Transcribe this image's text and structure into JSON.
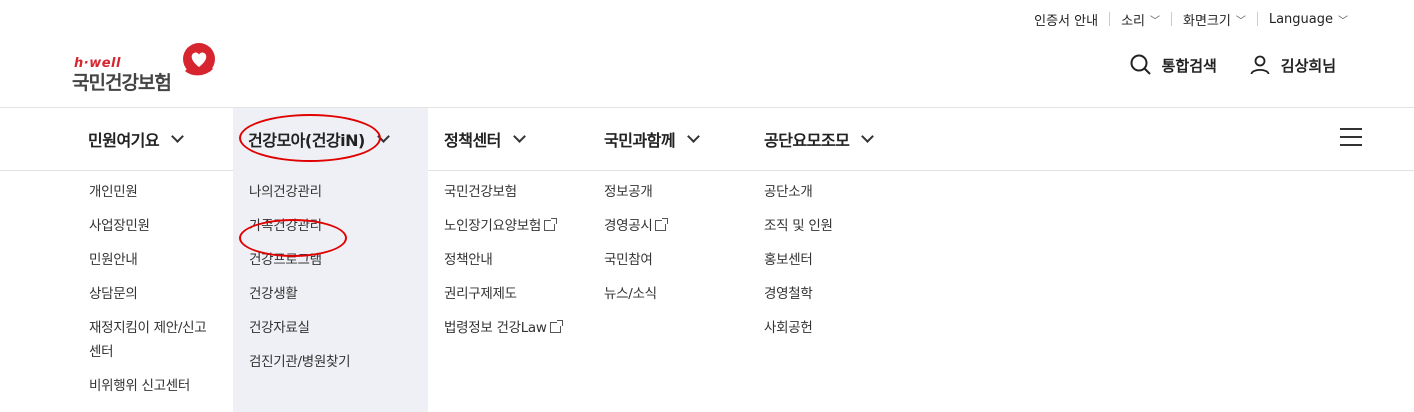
{
  "utility": {
    "cert": "인증서 안내",
    "sound": "소리",
    "screen_size": "화면크기",
    "language": "Language"
  },
  "logo": {
    "hwell": "h·well",
    "name": "국민건강보험"
  },
  "header": {
    "search": "통합검색",
    "user": "김상희님"
  },
  "gnb": [
    "민원여기요",
    "건강모아(건강iN)",
    "정책센터",
    "국민과함께",
    "공단요모조모"
  ],
  "submenus": {
    "col1": [
      "개인민원",
      "사업장민원",
      "민원안내",
      "상담문의",
      "재정지킴이 제안/신고",
      "센터",
      "비위행위 신고센터"
    ],
    "col2": [
      "나의건강관리",
      "가족건강관리",
      "건강프로그램",
      "건강생활",
      "건강자료실",
      "검진기관/병원찾기"
    ],
    "col3": [
      "국민건강보험",
      "노인장기요양보험",
      "정책안내",
      "권리구제제도",
      "법령정보 건강Law"
    ],
    "col4": [
      "정보공개",
      "경영공시",
      "국민참여",
      "뉴스/소식"
    ],
    "col5": [
      "공단소개",
      "조직 및 인원",
      "홍보센터",
      "경영철학",
      "사회공헌"
    ]
  },
  "colors": {
    "accent": "#d6252e",
    "active_bg": "#eef0f5",
    "annotation": "#e00000"
  }
}
